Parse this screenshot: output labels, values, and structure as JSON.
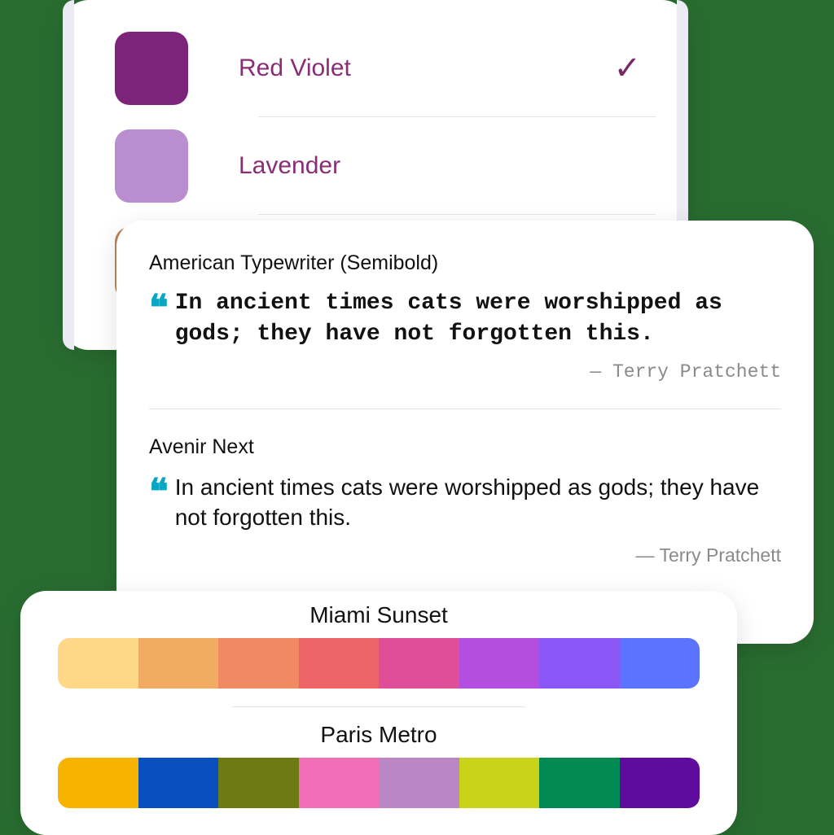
{
  "colors": {
    "items": [
      {
        "label": "Red Violet",
        "swatch": "#7c237a",
        "selected": true
      },
      {
        "label": "Lavender",
        "swatch": "#b98dcf",
        "selected": false
      },
      {
        "label": "",
        "swatch": "#bd8358",
        "selected": false
      }
    ]
  },
  "fonts": {
    "items": [
      {
        "name": "American Typewriter (Semibold)",
        "quote": "In ancient times cats were worshipped as gods; they have not forgotten this.",
        "author": "— Terry Pratchett",
        "style": "typewriter"
      },
      {
        "name": "Avenir Next",
        "quote": "In ancient times cats were worshipped as gods; they have not forgotten this.",
        "author": "— Terry Pratchett",
        "style": "avenir"
      }
    ],
    "quote_glyph": "❝"
  },
  "palettes": {
    "items": [
      {
        "name": "Miami Sunset",
        "colors": [
          "#ffd887",
          "#f2ab63",
          "#f18a64",
          "#ee6367",
          "#df4e98",
          "#b44ee0",
          "#8a56f5",
          "#5b73ff"
        ]
      },
      {
        "name": "Paris Metro",
        "colors": [
          "#f6b400",
          "#0a4fbf",
          "#6e7a14",
          "#f26fb7",
          "#bb86c4",
          "#c8d31a",
          "#008a52",
          "#5e0b9e"
        ]
      }
    ]
  }
}
